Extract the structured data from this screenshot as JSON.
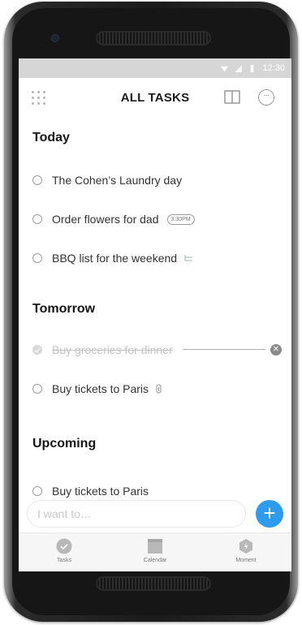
{
  "status_bar": {
    "time": "12:30"
  },
  "header": {
    "title": "ALL TASKS"
  },
  "sections": [
    {
      "heading": "Today",
      "tasks": [
        {
          "text": "The Cohen’s Laundry day",
          "completed": false
        },
        {
          "text": "Order flowers for dad",
          "completed": false,
          "time_badge": "3:30PM"
        },
        {
          "text": "BBQ list for the weekend",
          "completed": false,
          "icon": "subtasks-icon"
        }
      ]
    },
    {
      "heading": "Tomorrow",
      "tasks": [
        {
          "text": "Buy groceries for dinner",
          "completed": true
        },
        {
          "text": "Buy tickets to Paris",
          "completed": false,
          "icon": "attachment-icon"
        }
      ]
    },
    {
      "heading": "Upcoming",
      "tasks": [
        {
          "text": "Buy tickets to Paris",
          "completed": false
        }
      ]
    }
  ],
  "input": {
    "placeholder": "I want to…",
    "value": ""
  },
  "tabs": [
    {
      "label": "Tasks",
      "icon": "check-circle-icon",
      "active": true
    },
    {
      "label": "Calendar",
      "icon": "calendar-icon",
      "active": false
    },
    {
      "label": "Moment",
      "icon": "moment-icon",
      "active": false
    }
  ],
  "colors": {
    "accent": "#2d9bf0",
    "status_bar": "#d6d6d6",
    "tab_bar": "#f6f6f6"
  }
}
